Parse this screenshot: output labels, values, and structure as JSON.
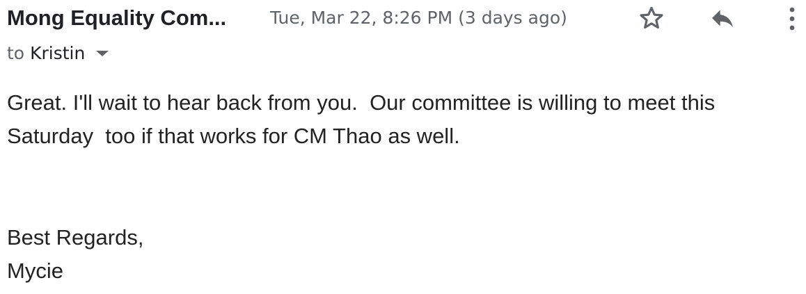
{
  "email": {
    "sender": "Mong Equality Com...",
    "date": "Tue, Mar 22, 8:26 PM (3 days ago)",
    "to_prefix": "to",
    "recipient": "Kristin",
    "body_lines": [
      "Great. I'll wait to hear back from you.  Our committee is willing to meet this",
      "Saturday  too if that works for CM Thao as well."
    ],
    "signature_lines": [
      "Best Regards,",
      "Mycie"
    ]
  },
  "icons": {
    "star": "star-icon",
    "reply": "reply-icon",
    "more": "more-vert-icon",
    "details": "caret-down-icon"
  },
  "colors": {
    "icon": "#5f6368",
    "sender": "#202124",
    "meta": "#5f6368",
    "body": "#222222"
  }
}
